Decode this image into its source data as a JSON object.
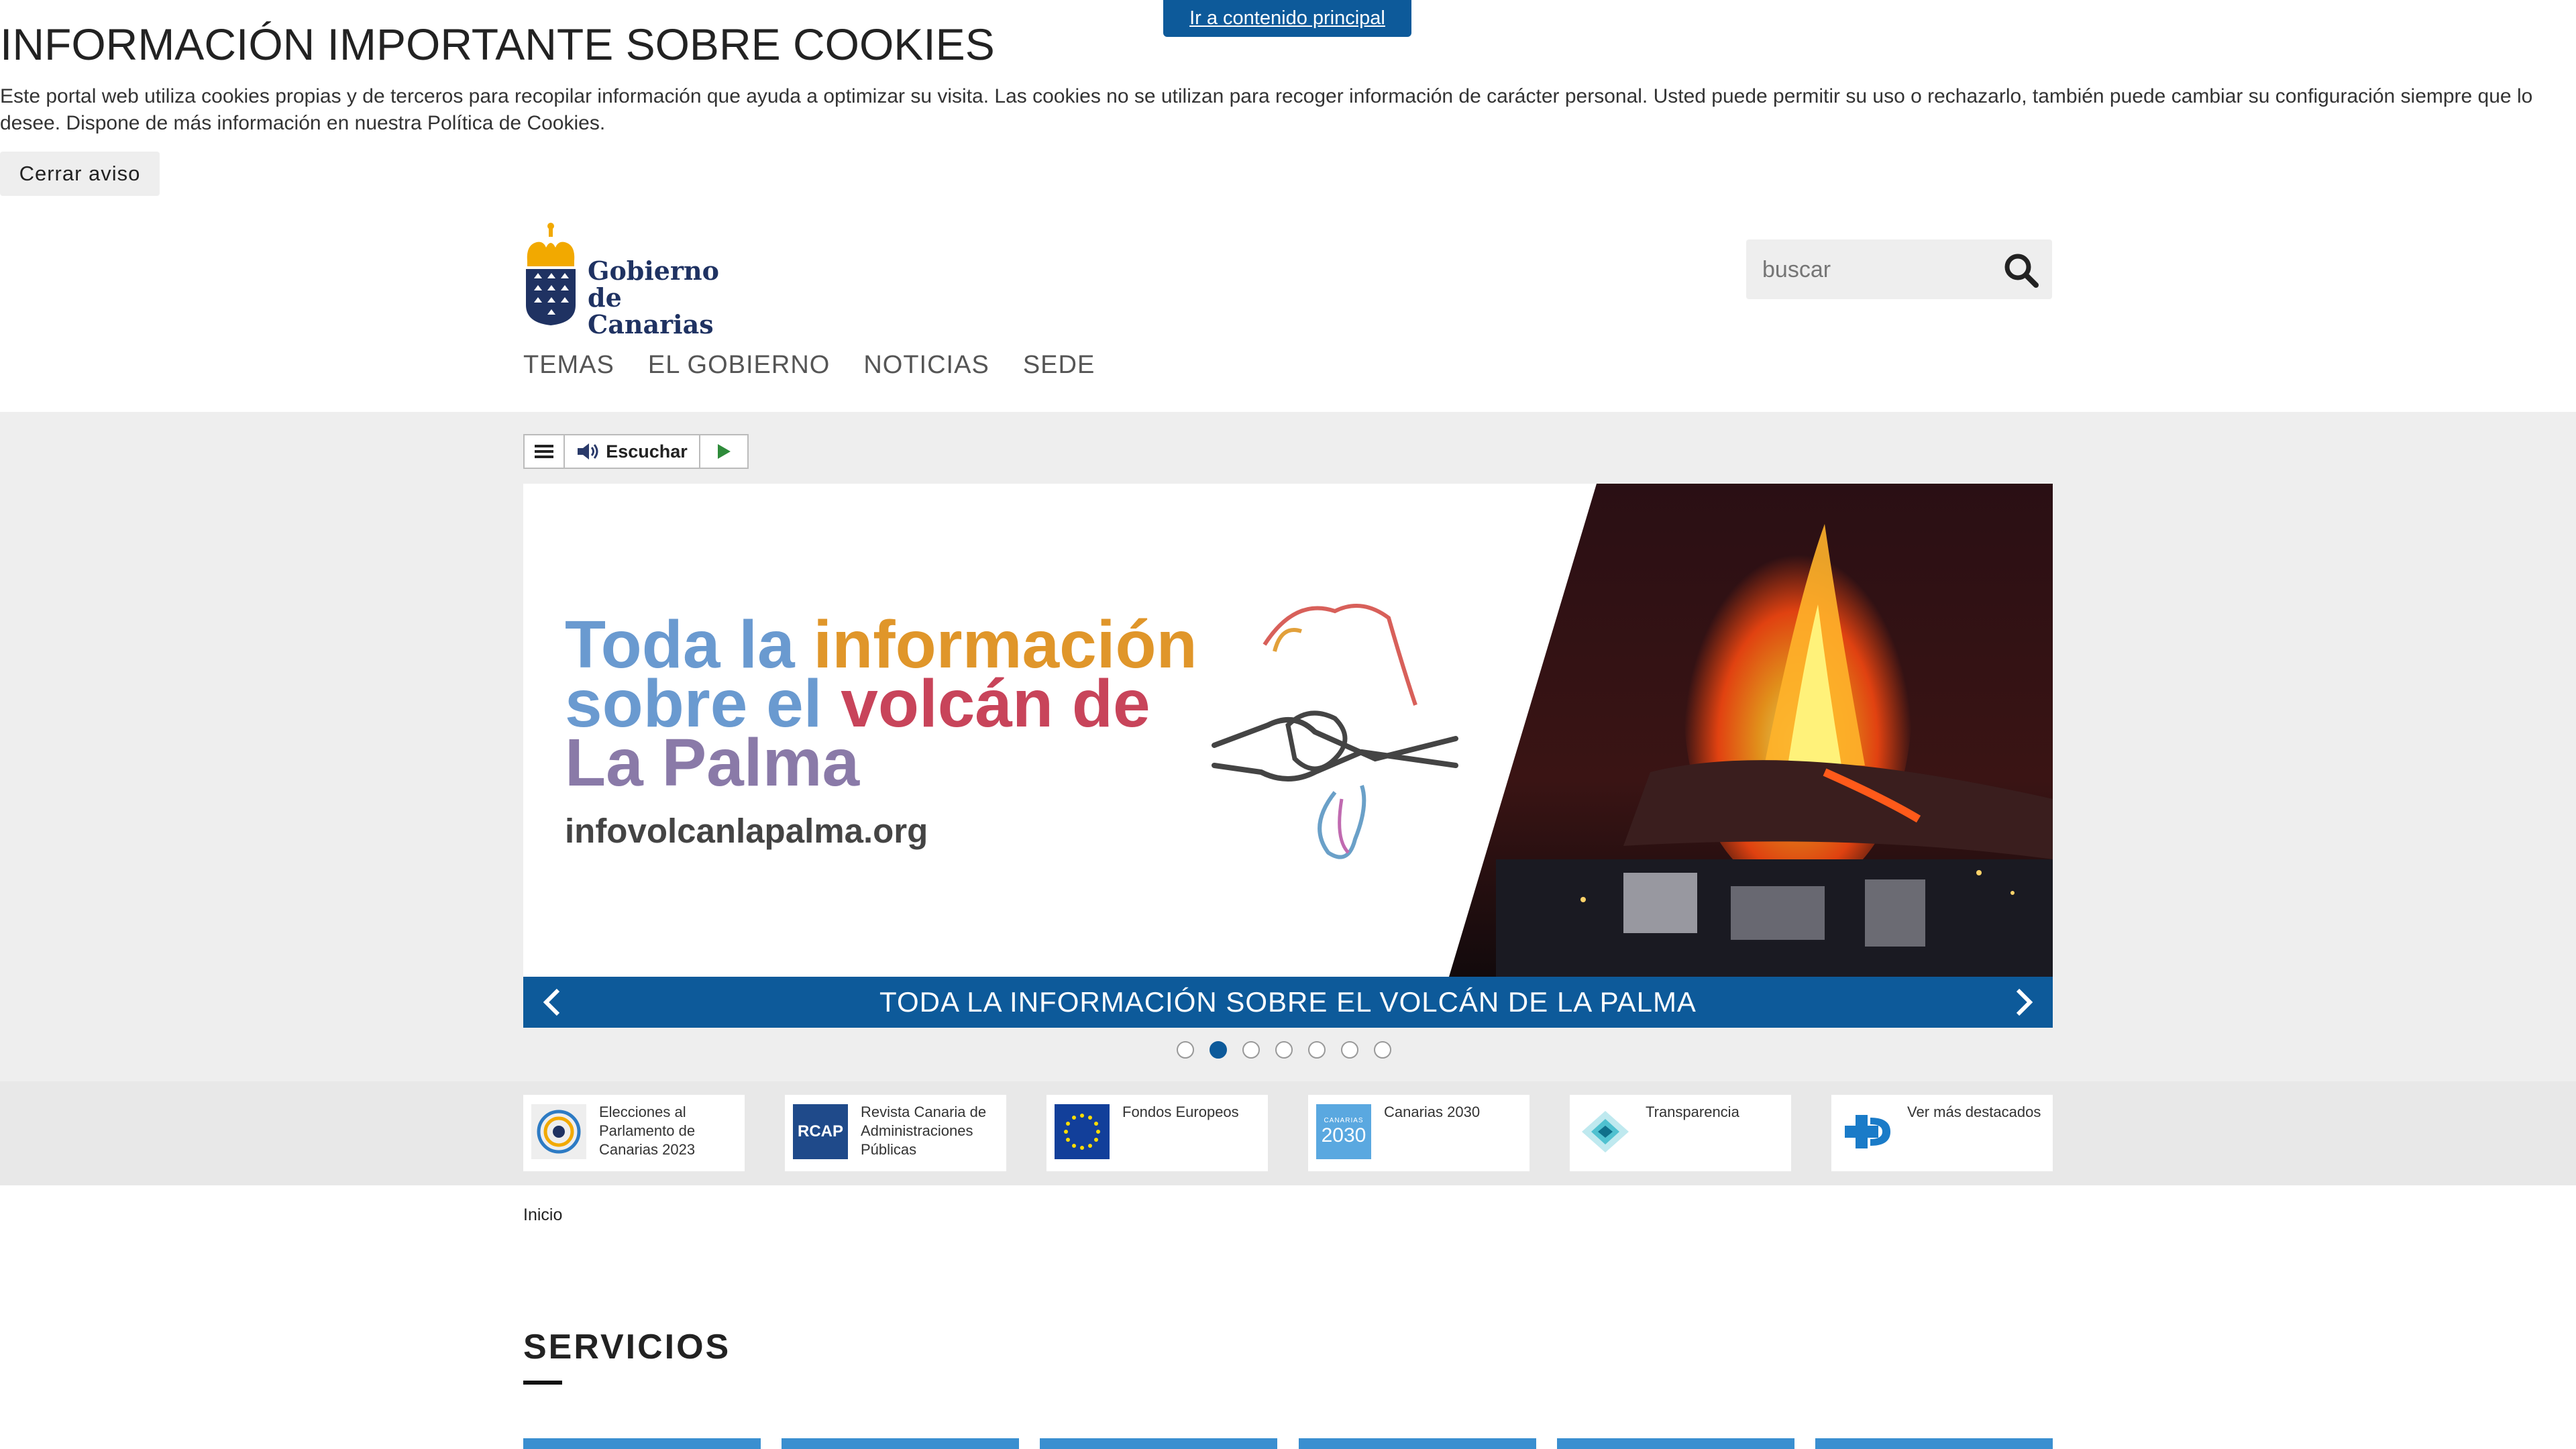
{
  "skip_link": "Ir a contenido principal",
  "cookie": {
    "title": "INFORMACIÓN IMPORTANTE SOBRE COOKIES",
    "text": "Este portal web utiliza cookies propias y de terceros para recopilar información que ayuda a optimizar su visita. Las cookies no se utilizan para recoger información de carácter personal. Usted puede permitir su uso o rechazarlo, también puede cambiar su configuración siempre que lo desee. Dispone de más información en nuestra Política de Cookies.",
    "close_label": "Cerrar aviso"
  },
  "header": {
    "logo_line1": "Gobierno",
    "logo_line2": "de Canarias",
    "search_placeholder": "buscar",
    "nav": [
      "TEMAS",
      "EL GOBIERNO",
      "NOTICIAS",
      "SEDE"
    ]
  },
  "tts": {
    "label": "Escuchar"
  },
  "slider": {
    "headline_line1_a": "Toda la ",
    "headline_line1_b": "información",
    "headline_line2_a": "sobre el ",
    "headline_line2_b": "volcán de",
    "headline_line3": "La Palma",
    "url": "infovolcanlapalma.org",
    "caption": "TODA LA INFORMACIÓN SOBRE EL VOLCÁN DE LA PALMA",
    "dot_count": 7,
    "active_dot": 2
  },
  "featured": [
    {
      "label": "Elecciones al Parlamento de Canarias 2023",
      "icon": "elections-seal-icon"
    },
    {
      "label": "Revista Canaria de Administraciones Públicas",
      "icon": "rcap-logo-icon",
      "icon_text": "RCAP"
    },
    {
      "label": "Fondos Europeos",
      "icon": "eu-flag-icon"
    },
    {
      "label": "Canarias 2030",
      "icon": "canarias-2030-icon",
      "icon_text_top": "CANARIAS",
      "icon_text": "2030"
    },
    {
      "label": "Transparencia",
      "icon": "transparency-diamond-icon"
    },
    {
      "label": "Ver más destacados",
      "icon": "plus-more-icon"
    }
  ],
  "breadcrumb": "Inicio",
  "services": {
    "title": "SERVICIOS",
    "tile_count": 6
  },
  "colors": {
    "primary": "#0d5a9a",
    "gold": "#f2a900",
    "navy": "#1f3262",
    "tile": "#3a8fd0"
  }
}
